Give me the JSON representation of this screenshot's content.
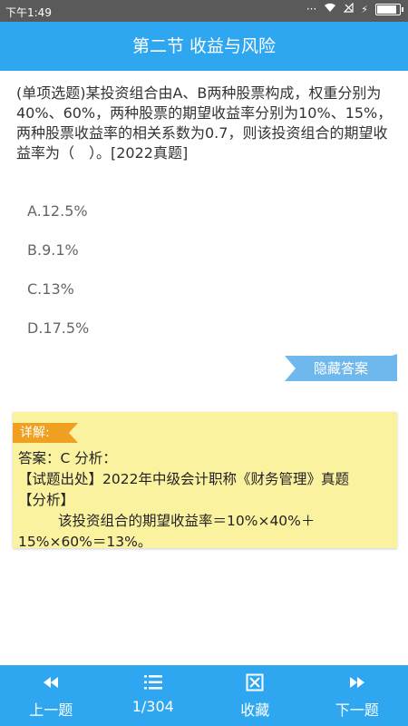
{
  "status_bar": {
    "time": "下午1:49",
    "battery_level": 0.8
  },
  "header": {
    "title": "第二节 收益与风险"
  },
  "question": {
    "text": "(单项选题)某投资组合由A、B两种股票构成，权重分别为40%、60%，两种股票的期望收益率分别为10%、15%，两种股票收益率的相关系数为0.7，则该投资组合的期望收益率为（　）。[2022真题]",
    "options": [
      "A.12.5%",
      "B.9.1%",
      "C.13%",
      "D.17.5%"
    ]
  },
  "hide_answer_label": "隐藏答案",
  "explanation": {
    "tag": "详解:",
    "answer_line": "答案：C 分析：",
    "source_line": "【试题出处】2022年中级会计职称《财务管理》真题",
    "analysis_label": "【分析】",
    "formula_line1": "该投资组合的期望收益率＝10%×40%＋",
    "formula_line2": "15%×60%＝13%。"
  },
  "bottom_nav": {
    "prev": "上一题",
    "page": "1/304",
    "favorite": "收藏",
    "next": "下一题"
  },
  "colors": {
    "accent": "#2ea7f0",
    "explanation_bg": "#fbf2a0",
    "tag": "#f0a020"
  }
}
